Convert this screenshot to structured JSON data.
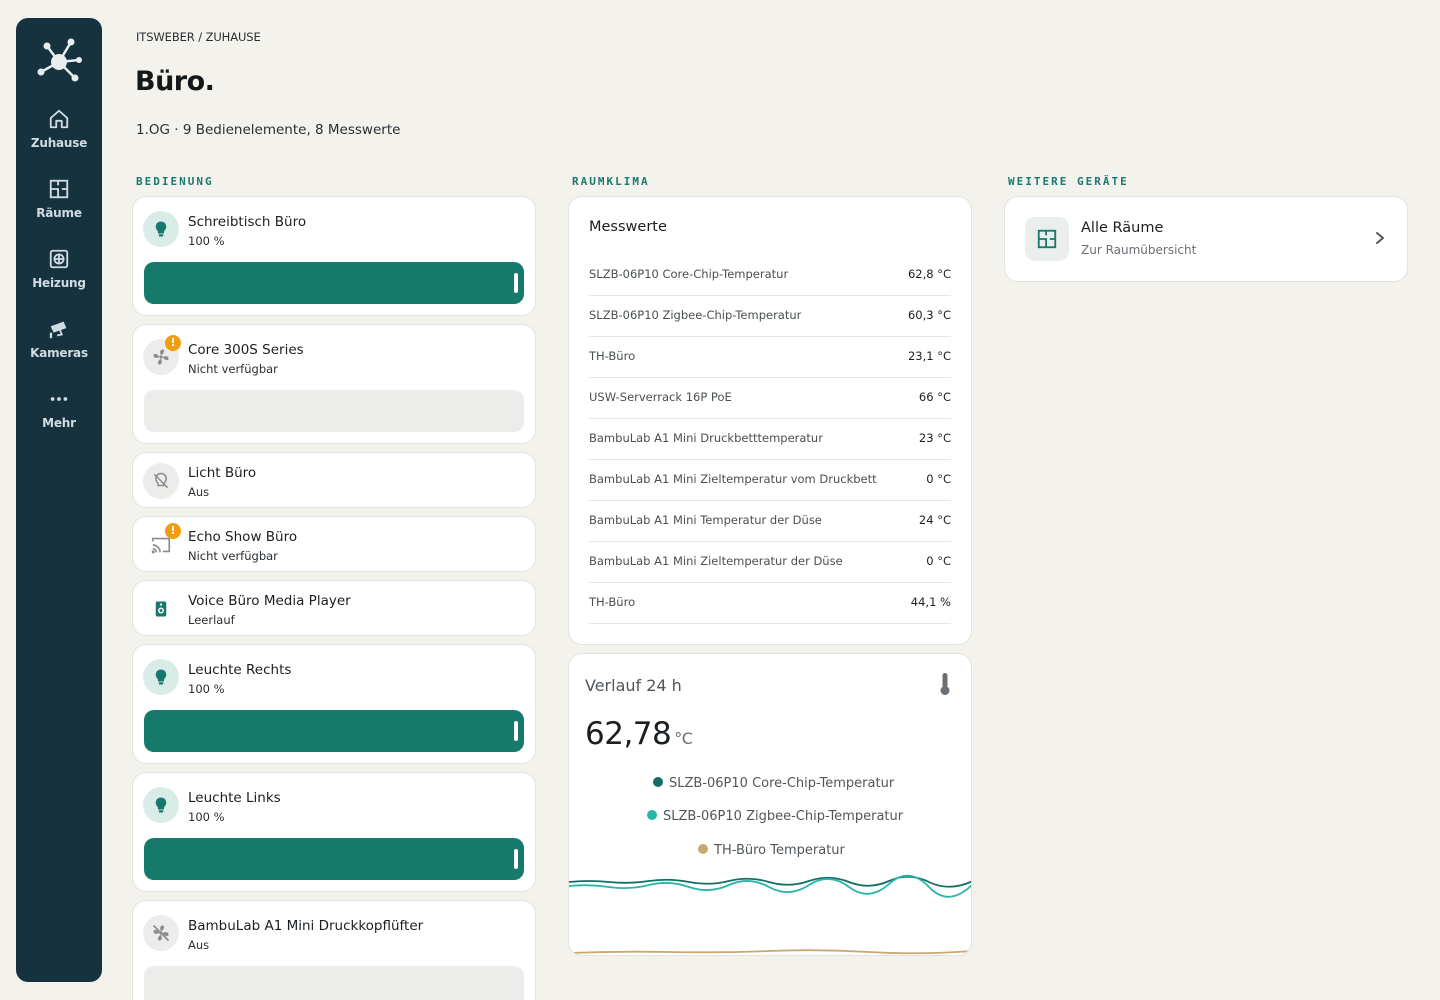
{
  "nav": {
    "items": [
      {
        "label": "Zuhause",
        "icon": "home-icon"
      },
      {
        "label": "Räume",
        "icon": "floorplan-icon"
      },
      {
        "label": "Heizung",
        "icon": "radiator-icon"
      },
      {
        "label": "Kameras",
        "icon": "camera-icon"
      },
      {
        "label": "Mehr",
        "icon": "more-dots-icon"
      }
    ]
  },
  "header": {
    "breadcrumb": "ITSWEBER / ZUHAUSE",
    "title": "Büro.",
    "subtitle": "1.OG · 9 Bedienelemente, 8 Messwerte"
  },
  "sections": {
    "controls": "BEDIENUNG",
    "climate": "RAUMKLIMA",
    "more": "WEITERE GERÄTE"
  },
  "devices": [
    {
      "name": "Schreibtisch Büro",
      "state": "100 %",
      "icon": "bulb-icon",
      "level": 100
    },
    {
      "name": "Core 300S Series",
      "state": "Nicht verfügbar",
      "icon": "fan-icon",
      "warning": true
    },
    {
      "name": "Licht Büro",
      "state": "Aus",
      "icon": "bulb-off-icon"
    },
    {
      "name": "Echo Show Büro",
      "state": "Nicht verfügbar",
      "icon": "cast-icon",
      "warning": true
    },
    {
      "name": "Voice Büro Media Player",
      "state": "Leerlauf",
      "icon": "speaker-icon"
    },
    {
      "name": "Leuchte Rechts",
      "state": "100 %",
      "icon": "bulb-icon",
      "level": 100
    },
    {
      "name": "Leuchte Links",
      "state": "100 %",
      "icon": "bulb-icon",
      "level": 100
    },
    {
      "name": "BambuLab A1 Mini Druckkopflüfter",
      "state": "Aus",
      "icon": "fan-off-icon"
    }
  ],
  "measurements": {
    "title": "Messwerte",
    "rows": [
      {
        "name": "SLZB-06P10 Core-Chip-Temperatur",
        "value": "62,8 °C"
      },
      {
        "name": "SLZB-06P10 Zigbee-Chip-Temperatur",
        "value": "60,3 °C"
      },
      {
        "name": "TH-Büro",
        "value": "23,1 °C"
      },
      {
        "name": "USW-Serverrack 16P PoE",
        "value": "66 °C"
      },
      {
        "name": "BambuLab A1 Mini Druckbetttemperatur",
        "value": "23 °C"
      },
      {
        "name": "BambuLab A1 Mini Zieltemperatur vom Druckbett",
        "value": "0 °C"
      },
      {
        "name": "BambuLab A1 Mini Temperatur der Düse",
        "value": "24 °C"
      },
      {
        "name": "BambuLab A1 Mini Zieltemperatur der Düse",
        "value": "0 °C"
      },
      {
        "name": "TH-Büro",
        "value": "44,1 %"
      }
    ]
  },
  "history": {
    "title": "Verlauf 24 h",
    "value": "62,78",
    "unit": "°C",
    "icon": "thermometer-icon",
    "legend": [
      {
        "name": "SLZB-06P10 Core-Chip-Temperatur",
        "color": "#136f63"
      },
      {
        "name": "SLZB-06P10 Zigbee-Chip-Temperatur",
        "color": "#2ab5aa"
      },
      {
        "name": "TH-Büro Temperatur",
        "color": "#c9a96e"
      }
    ]
  },
  "more_devices": {
    "title": "Alle Räume",
    "subtitle": "Zur Raumübersicht",
    "icon": "floorplan-icon"
  },
  "colors": {
    "accent": "#157a6c",
    "sidebar": "#16323f",
    "warning": "#f39c12",
    "background": "#f3f2ed"
  }
}
